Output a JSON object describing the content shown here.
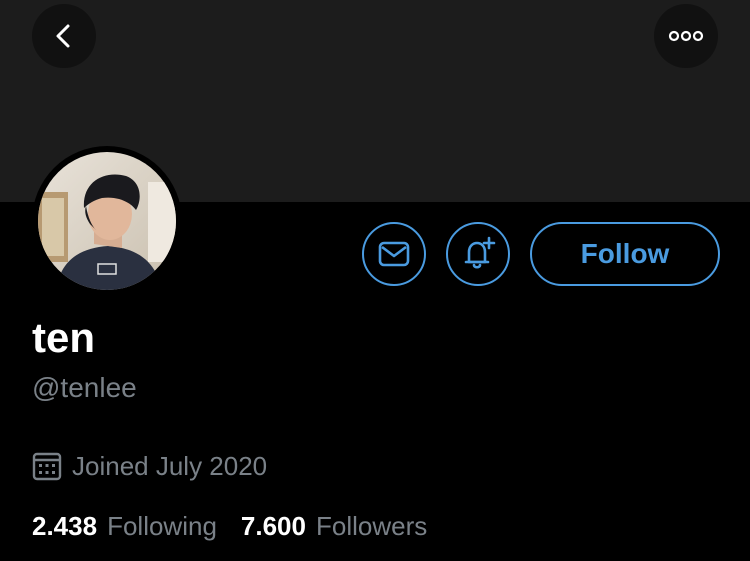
{
  "profile": {
    "display_name": "ten",
    "handle": "@tenlee",
    "joined": "Joined July 2020",
    "following_count": "2.438",
    "following_label": "Following",
    "followers_count": "7.600",
    "followers_label": "Followers"
  },
  "actions": {
    "follow_label": "Follow"
  },
  "icons": {
    "back": "chevron-left-icon",
    "more": "more-dots-icon",
    "message": "envelope-icon",
    "notify": "bell-plus-icon",
    "calendar": "calendar-icon"
  },
  "colors": {
    "accent": "#4a9be0",
    "secondary_text": "#7a8188",
    "background": "#000000",
    "banner": "#1c1c1c"
  }
}
